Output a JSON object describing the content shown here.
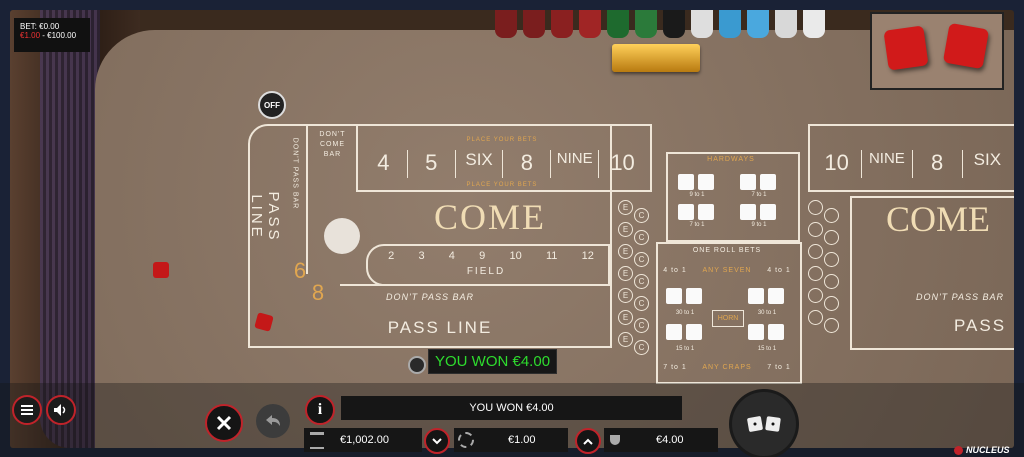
{
  "bet_panel": {
    "bet_label": "BET: €0.00",
    "limits_min": "€1.00",
    "limits_max": " - €100.00"
  },
  "off_puck": "OFF",
  "table": {
    "dont_come_bar": "DON'T COME BAR",
    "dont_pass_bar_vertical": "DON'T PASS BAR",
    "place_your_bets": "PLACE YOUR BETS",
    "place_numbers": [
      "4",
      "5",
      "SIX",
      "8",
      "NINE",
      "10"
    ],
    "pass_line_vertical": "PASS LINE",
    "come": "COME",
    "field_numbers": [
      "2",
      "3",
      "4",
      "9",
      "10",
      "11",
      "12"
    ],
    "field_label": "FIELD",
    "big6": "6",
    "big8": "8",
    "dont_pass_bar": "DON'T PASS BAR",
    "pass_line": "PASS LINE",
    "come_markers": [
      "E",
      "C",
      "E",
      "C",
      "E",
      "C",
      "E",
      "C",
      "E",
      "C",
      "E",
      "C",
      "E",
      "C"
    ],
    "hardways_label": "HARDWAYS",
    "hardways_odds": [
      "9 to 1",
      "7 to 1",
      "7 to 1",
      "9 to 1"
    ],
    "one_roll_bets": "ONE ROLL BETS",
    "any_seven": "ANY SEVEN",
    "any_seven_odds_left": "4 to 1",
    "any_seven_odds_right": "4 to 1",
    "horn": "HORN",
    "prop_odds": [
      "30 to 1",
      "30 to 1",
      "15 to 1",
      "15 to 1"
    ],
    "any_craps": "ANY CRAPS",
    "any_craps_odds_left": "7 to 1",
    "any_craps_odds_right": "7 to 1",
    "mirror_numbers": [
      "10",
      "NINE",
      "8",
      "SIX"
    ],
    "mirror_come": "COME",
    "mirror_dont_pass": "DON'T PASS BAR",
    "mirror_pass": "PASS"
  },
  "win_popup": "YOU WON €4.00",
  "bottom": {
    "message": "YOU WON €4.00",
    "balance": "€1,002.00",
    "chip_value": "€1.00",
    "win_amount": "€4.00",
    "brand": "NUCLEUS"
  },
  "colors": {
    "felt": "#8b7563",
    "accent_red": "#c0232a",
    "win_green": "#2edc2e"
  }
}
